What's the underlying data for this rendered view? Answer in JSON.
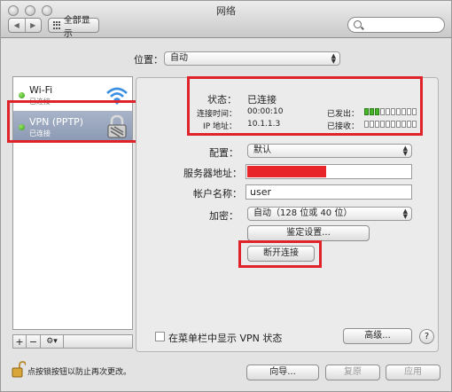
{
  "window": {
    "title": "网络"
  },
  "toolbar": {
    "back_glyph": "◀",
    "forward_glyph": "▶",
    "show_all_label": "全部显示",
    "search_placeholder": ""
  },
  "location": {
    "label": "位置：",
    "value": "自动"
  },
  "sidebar": {
    "items": [
      {
        "name": "Wi-Fi",
        "status": "已连接",
        "icon": "wifi-icon",
        "status_color": "#3aa71c"
      },
      {
        "name": "VPN (PPTP)",
        "status": "已连接",
        "icon": "lock-icon",
        "status_color": "#3aa71c",
        "selected": true
      }
    ],
    "add_glyph": "+",
    "remove_glyph": "−",
    "action_glyph": "⚙▾"
  },
  "status": {
    "label": "状态：",
    "value": "已连接",
    "connect_time_label": "连接时间：",
    "connect_time_value": "00:00:10",
    "ip_label": "IP 地址：",
    "ip_value": "10.1.1.3",
    "sent_label": "已发出：",
    "received_label": "已接收：",
    "sent_level": 0.25,
    "received_level": 0.0
  },
  "form": {
    "config_label": "配置：",
    "config_value": "默认",
    "server_label": "服务器地址：",
    "server_value": "",
    "account_label": "帐户名称：",
    "account_value": "user",
    "encryption_label": "加密：",
    "encryption_value": "自动（128 位或 40 位）",
    "auth_button": "鉴定设置...",
    "disconnect_button": "断开连接"
  },
  "options": {
    "show_vpn_status_label": "在菜单栏中显示 VPN 状态",
    "advanced_button": "高级...",
    "help_glyph": "?"
  },
  "footer": {
    "lock_text": "点按锁按钮以防止再次更改。",
    "assistant_button": "向导...",
    "revert_button": "复原",
    "apply_button": "应用"
  },
  "colors": {
    "highlight_red": "#e0222a",
    "selected_row": "#96a3bb",
    "connected_green": "#3aa71c"
  }
}
